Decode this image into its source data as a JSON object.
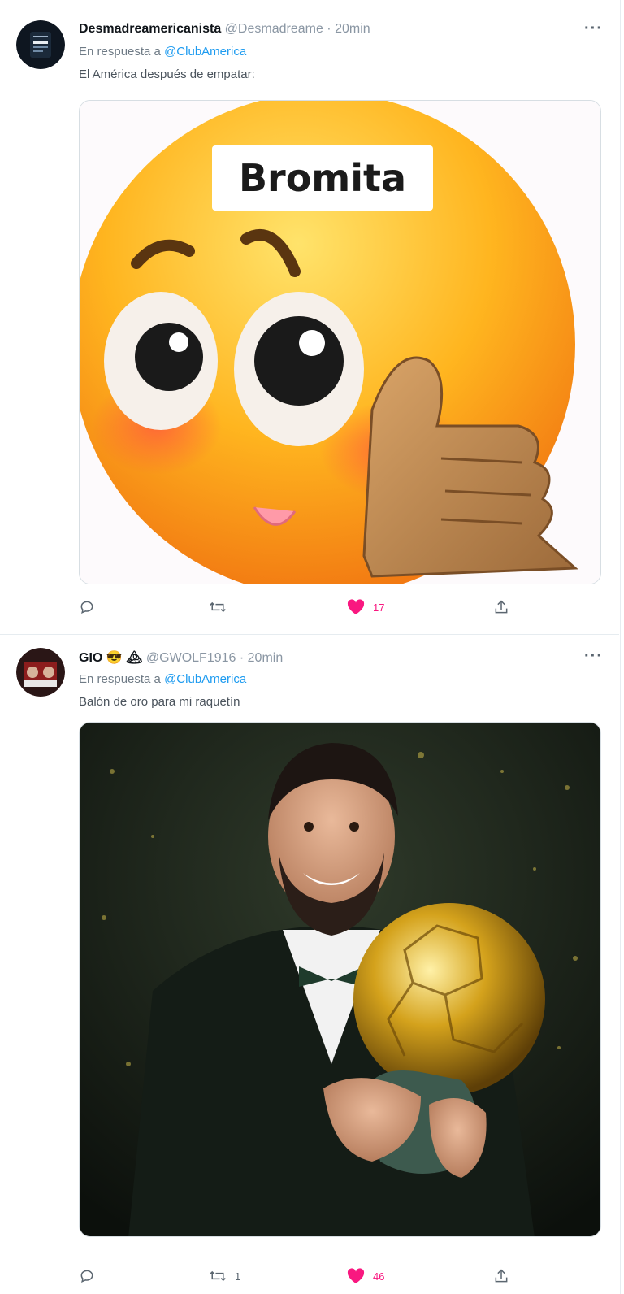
{
  "tweets": [
    {
      "name": "Desmadreamericanista",
      "handle": "@Desmadreame · 20min",
      "reply_prefix": "En respuesta a",
      "reply_mention": "@ClubAmerica",
      "text": "El América después de empatar:",
      "media_caption": "Bromita",
      "more": "···",
      "replies": "",
      "retweets": "",
      "likes": "17",
      "liked": true
    },
    {
      "name": "GIO 😎 🏔",
      "handle": "@GWOLF1916 · 20min",
      "reply_prefix": "En respuesta a",
      "reply_mention": "@ClubAmerica",
      "text": "Balón de oro para mi raquetín",
      "more": "···",
      "replies": "",
      "retweets": "1",
      "likes": "46",
      "liked": true
    }
  ],
  "colors": {
    "accent": "#1d9bf0",
    "like": "#f91880",
    "muted": "#8a96a3"
  },
  "icons": [
    "comment-icon",
    "retweet-icon",
    "heart-icon",
    "share-icon",
    "more-icon"
  ]
}
